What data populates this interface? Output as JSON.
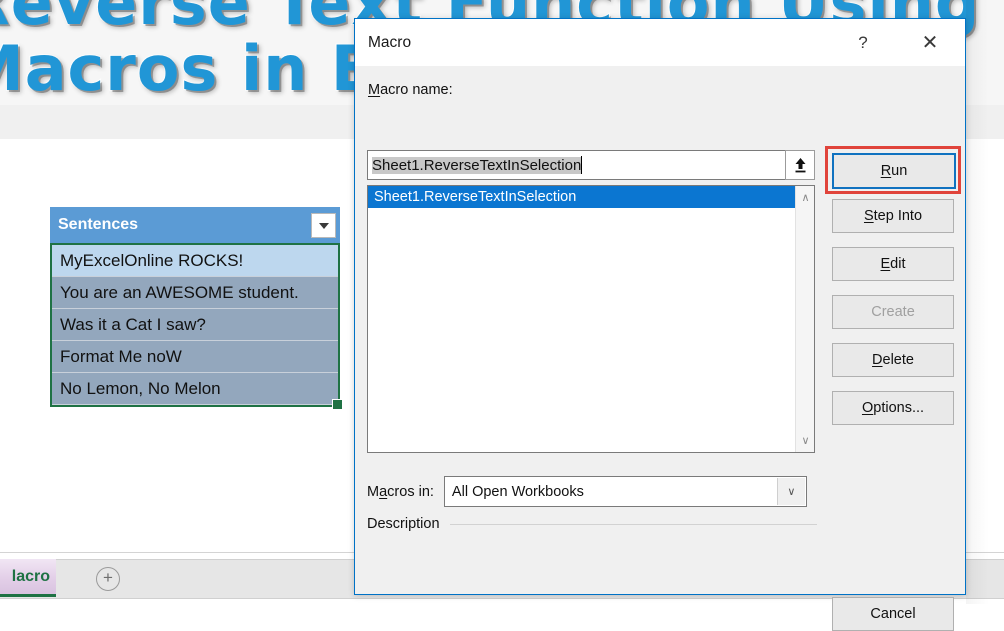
{
  "background": {
    "banner_title_line1": "Reverse Text Function Using",
    "banner_title_line2": "Macros in Excel",
    "banner_color": "#2196d6"
  },
  "worksheet": {
    "table": {
      "header": "Sentences",
      "filter_icon": "chevron-down-icon",
      "rows": [
        "MyExcelOnline ROCKS!",
        "You are an AWESOME student.",
        "Was it a Cat I saw?",
        "Format Me noW",
        "No Lemon, No Melon"
      ],
      "selection_border_color": "#1f7244",
      "active_row_color": "#bdd7ee",
      "selected_row_color": "#93a7bd",
      "header_color": "#5b9bd5"
    },
    "tabs": {
      "sheet_tab_label": "lacro",
      "add_sheet_label": "+"
    }
  },
  "dialog": {
    "title": "Macro",
    "help_label": "?",
    "close_label": "✕",
    "macro_name_label": "Macro name:",
    "macro_name_value": "Sheet1.ReverseTextInSelection",
    "upload_icon": "upload-arrow-icon",
    "list": {
      "items": [
        "Sheet1.ReverseTextInSelection"
      ],
      "selected_index": 0,
      "selection_color": "#0b76d1"
    },
    "scrollbar": {
      "up_arrow": "∧",
      "down_arrow": "∨"
    },
    "macros_in_label": "Macros in:",
    "macros_in_value": "All Open Workbooks",
    "macros_in_caret": "∨",
    "description_label": "Description",
    "buttons": {
      "run": "Run",
      "step_into": "Step Into",
      "edit": "Edit",
      "create": "Create",
      "delete": "Delete",
      "options": "Options...",
      "cancel": "Cancel"
    },
    "run_highlight_color": "#e0443b",
    "run_focus_color": "#1072c0",
    "border_color": "#0072c6"
  }
}
